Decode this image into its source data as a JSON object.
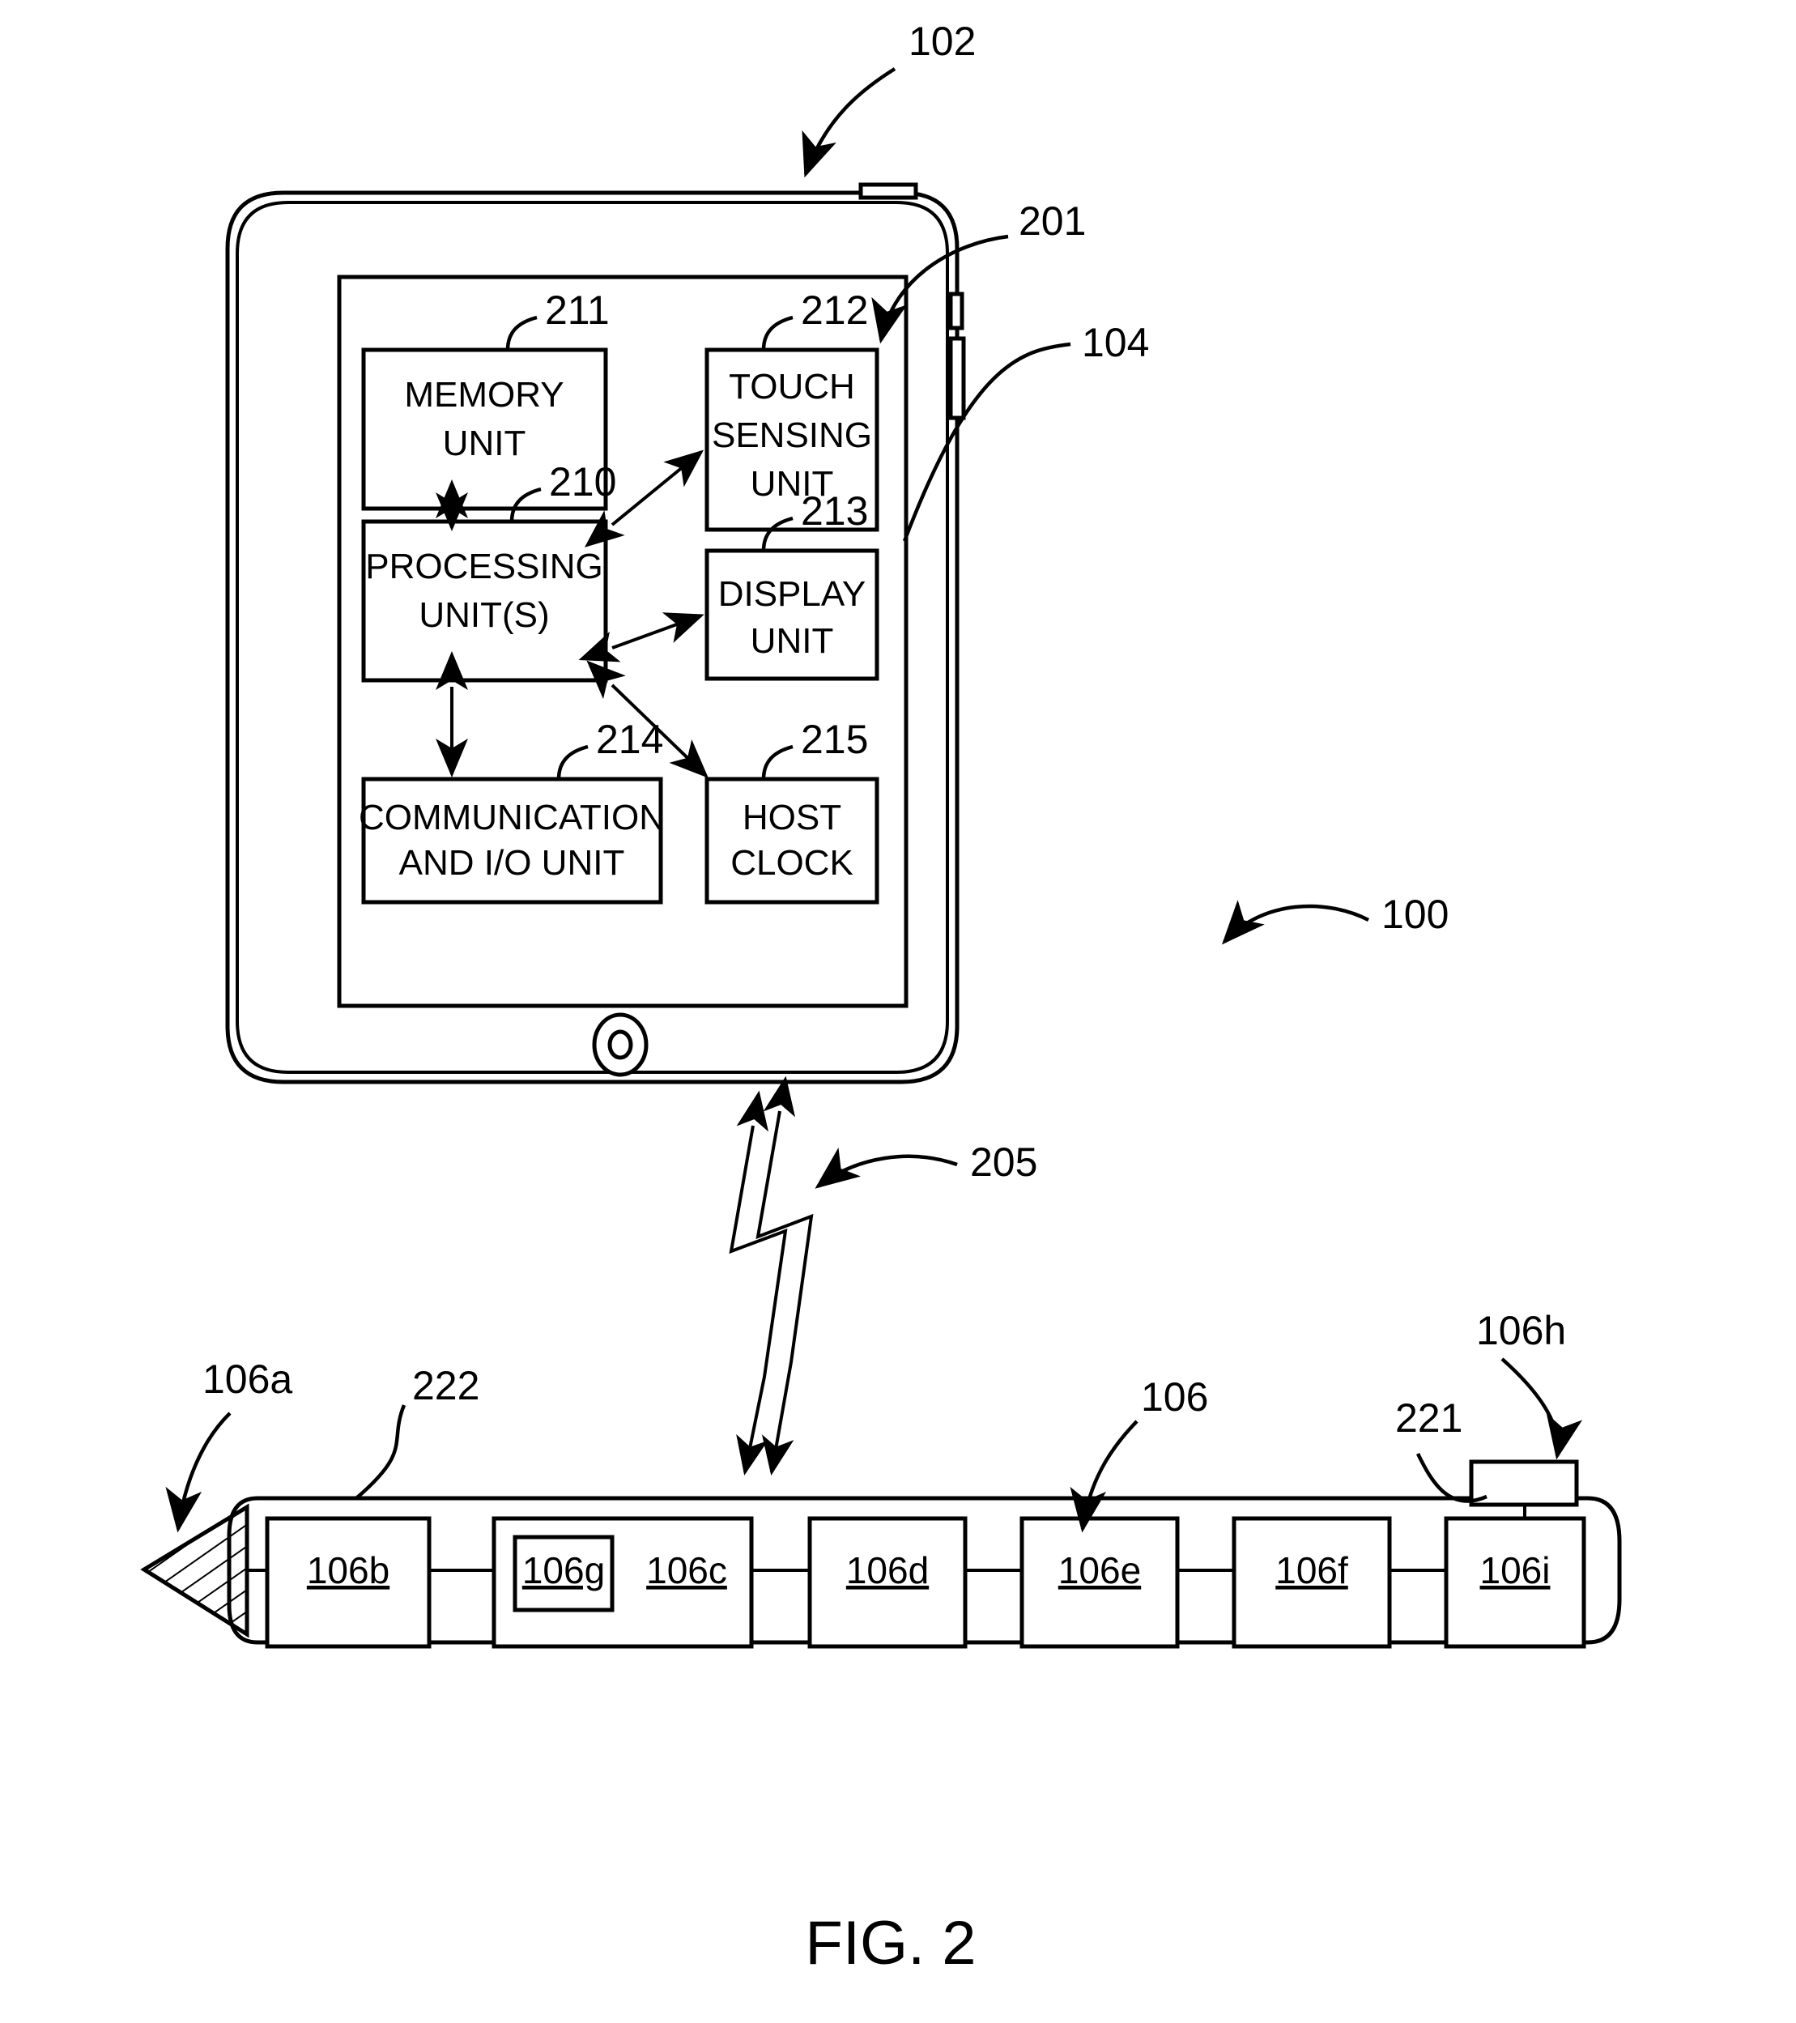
{
  "figure": {
    "caption": "FIG. 2",
    "system_label": "100"
  },
  "host_device": {
    "device_ref": "102",
    "housing_ref": "104",
    "screen_ref": "201",
    "home_button_name": "home-button",
    "blocks": [
      {
        "id": "memory",
        "ref": "211",
        "line1": "MEMORY",
        "line2": "UNIT"
      },
      {
        "id": "touch",
        "ref": "212",
        "line1": "TOUCH",
        "line2": "SENSING",
        "line3": "UNIT"
      },
      {
        "id": "processing",
        "ref": "210",
        "line1": "PROCESSING",
        "line2": "UNIT(S)"
      },
      {
        "id": "display",
        "ref": "213",
        "line1": "DISPLAY",
        "line2": "UNIT"
      },
      {
        "id": "comm",
        "ref": "214",
        "line1": "COMMUNICATION",
        "line2": "AND I/O UNIT"
      },
      {
        "id": "clock",
        "ref": "215",
        "line1": "HOST",
        "line2": "CLOCK"
      }
    ]
  },
  "wireless_link": {
    "ref": "205"
  },
  "stylus": {
    "body_ref": "106",
    "tip_ref": "106a",
    "barrel_ref": "222",
    "button_ref": "221",
    "cap_ref": "106h",
    "blocks": [
      {
        "id": "b",
        "label": "106b"
      },
      {
        "id": "c",
        "label": "106c"
      },
      {
        "id": "g",
        "label": "106g"
      },
      {
        "id": "d",
        "label": "106d"
      },
      {
        "id": "e",
        "label": "106e"
      },
      {
        "id": "f",
        "label": "106f"
      },
      {
        "id": "i",
        "label": "106i"
      }
    ]
  }
}
